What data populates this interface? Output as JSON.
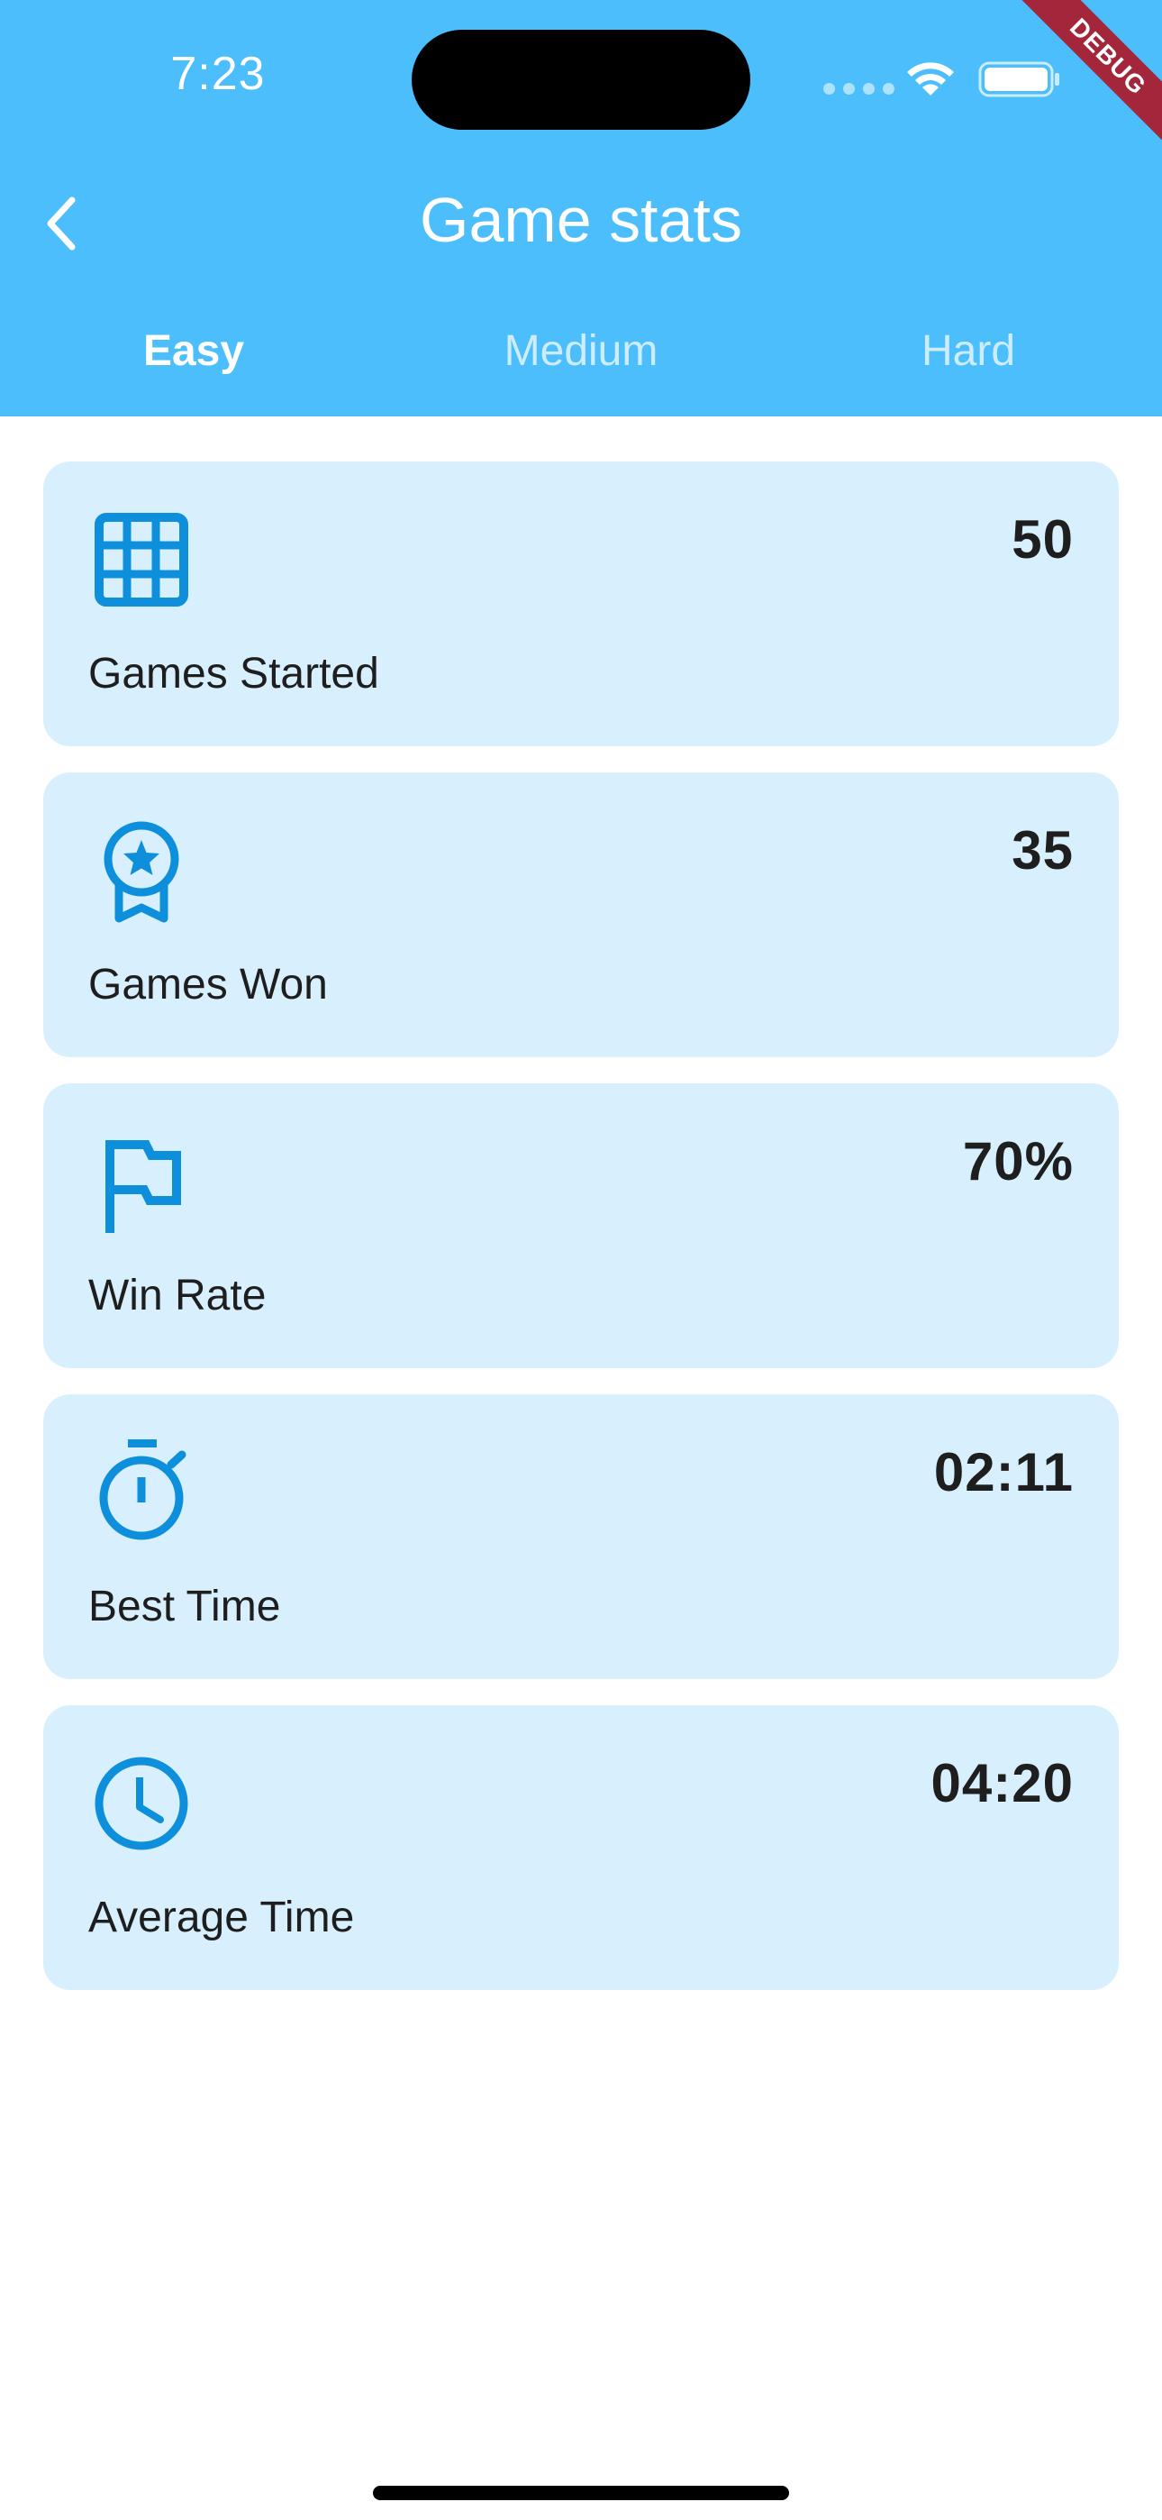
{
  "status_bar": {
    "time": "7:23"
  },
  "debug_banner": "DEBUG",
  "app_bar": {
    "title": "Game stats",
    "back_icon": "chevron-left-icon"
  },
  "tabs": [
    {
      "label": "Easy",
      "selected": true
    },
    {
      "label": "Medium",
      "selected": false
    },
    {
      "label": "Hard",
      "selected": false
    }
  ],
  "stats": [
    {
      "icon": "grid-icon",
      "value": "50",
      "label": "Games Started"
    },
    {
      "icon": "award-icon",
      "value": "35",
      "label": "Games Won"
    },
    {
      "icon": "flag-icon",
      "value": "70%",
      "label": "Win Rate"
    },
    {
      "icon": "stopwatch-icon",
      "value": "02:11",
      "label": "Best Time"
    },
    {
      "icon": "clock-icon",
      "value": "04:20",
      "label": "Average Time"
    }
  ],
  "colors": {
    "header": "#4BBEFB",
    "card": "#D8F0FD",
    "icon": "#0E8FDB",
    "text": "#1E1E1E"
  }
}
